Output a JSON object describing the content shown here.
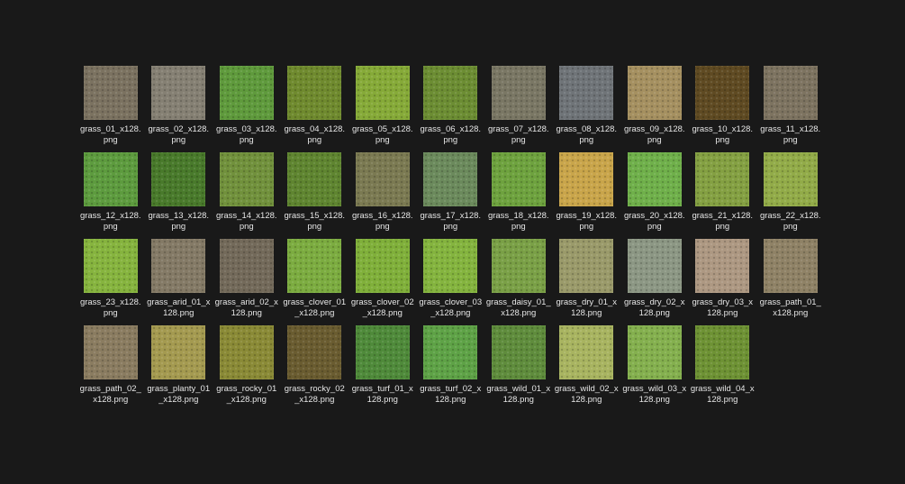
{
  "files": [
    {
      "name": "grass_01_x128.png",
      "color": "#7b7260"
    },
    {
      "name": "grass_02_x128.png",
      "color": "#858073"
    },
    {
      "name": "grass_03_x128.png",
      "color": "#5f9a3c"
    },
    {
      "name": "grass_04_x128.png",
      "color": "#6f8a2e"
    },
    {
      "name": "grass_05_x128.png",
      "color": "#86aa38"
    },
    {
      "name": "grass_06_x128.png",
      "color": "#6c8d33"
    },
    {
      "name": "grass_07_x128.png",
      "color": "#7a7764"
    },
    {
      "name": "grass_08_x128.png",
      "color": "#6f7478"
    },
    {
      "name": "grass_09_x128.png",
      "color": "#a59060"
    },
    {
      "name": "grass_10_x128.png",
      "color": "#5f4a22"
    },
    {
      "name": "grass_11_x128.png",
      "color": "#7d7360"
    },
    {
      "name": "grass_12_x128.png",
      "color": "#5d9b3e"
    },
    {
      "name": "grass_13_x128.png",
      "color": "#497a2b"
    },
    {
      "name": "grass_14_x128.png",
      "color": "#71913c"
    },
    {
      "name": "grass_15_x128.png",
      "color": "#5f8530"
    },
    {
      "name": "grass_16_x128.png",
      "color": "#7b7a52"
    },
    {
      "name": "grass_17_x128.png",
      "color": "#6b8a5c"
    },
    {
      "name": "grass_18_x128.png",
      "color": "#6ea23e"
    },
    {
      "name": "grass_19_x128.png",
      "color": "#c9a54a"
    },
    {
      "name": "grass_20_x128.png",
      "color": "#6fb04a"
    },
    {
      "name": "grass_21_x128.png",
      "color": "#84a042"
    },
    {
      "name": "grass_22_x128.png",
      "color": "#92ab48"
    },
    {
      "name": "grass_23_x128.png",
      "color": "#86b43e"
    },
    {
      "name": "grass_arid_01_x128.png",
      "color": "#847a66"
    },
    {
      "name": "grass_arid_02_x128.png",
      "color": "#736a5a"
    },
    {
      "name": "grass_clover_01_x128.png",
      "color": "#7cac40"
    },
    {
      "name": "grass_clover_02_x128.png",
      "color": "#80b03a"
    },
    {
      "name": "grass_clover_03_x128.png",
      "color": "#84b43e"
    },
    {
      "name": "grass_daisy_01_x128.png",
      "color": "#7aa046"
    },
    {
      "name": "grass_dry_01_x128.png",
      "color": "#9a9a6a"
    },
    {
      "name": "grass_dry_02_x128.png",
      "color": "#8c9784"
    },
    {
      "name": "grass_dry_03_x128.png",
      "color": "#ad9882"
    },
    {
      "name": "grass_path_01_x128.png",
      "color": "#8f8266"
    },
    {
      "name": "grass_path_02_x128.png",
      "color": "#8a7c60"
    },
    {
      "name": "grass_planty_01_x128.png",
      "color": "#a49a50"
    },
    {
      "name": "grass_rocky_01_x128.png",
      "color": "#8a8a36"
    },
    {
      "name": "grass_rocky_02_x128.png",
      "color": "#6a5c30"
    },
    {
      "name": "grass_turf_01_x128.png",
      "color": "#4f8a3a"
    },
    {
      "name": "grass_turf_02_x128.png",
      "color": "#5ea246"
    },
    {
      "name": "grass_wild_01_x128.png",
      "color": "#5f8c3c"
    },
    {
      "name": "grass_wild_02_x128.png",
      "color": "#a8b460"
    },
    {
      "name": "grass_wild_03_x128.png",
      "color": "#84b04e"
    },
    {
      "name": "grass_wild_04_x128.png",
      "color": "#6e9234"
    }
  ]
}
